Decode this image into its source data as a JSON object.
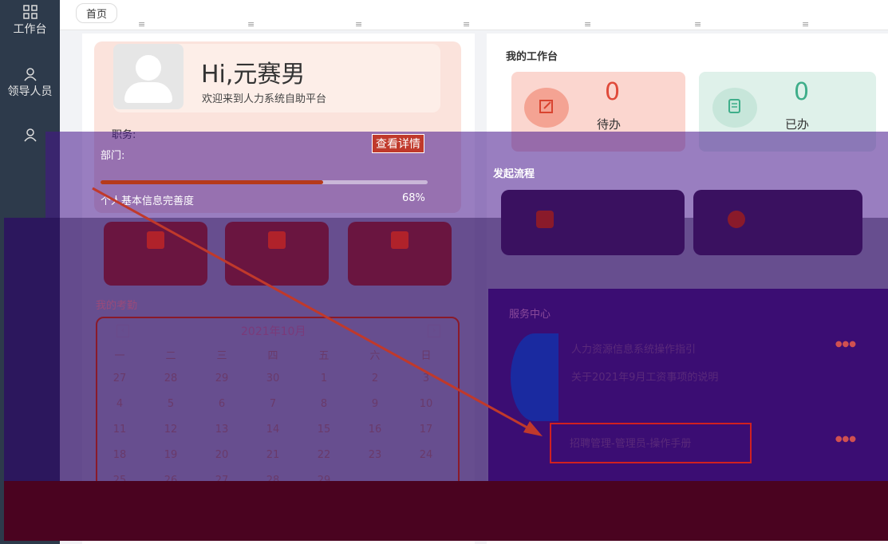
{
  "sidebar": {
    "items": [
      {
        "label": "工作台",
        "icon": "grid-icon"
      },
      {
        "label": "领导人员",
        "icon": "person-icon"
      },
      {
        "label": "",
        "icon": "person-icon"
      }
    ]
  },
  "topbar": {
    "tab": "首页"
  },
  "profile": {
    "greeting": "Hi,元赛男",
    "welcome": "欢迎来到人力系统自助平台",
    "position_label": "职务:",
    "department_label": "部门:",
    "detail_button": "查看详情",
    "completeness_label": "个人基本信息完善度",
    "completeness_pct": "68%",
    "completeness_value": 0.68
  },
  "calendar": {
    "title": "我的考勤",
    "month": "2021年10月",
    "weekdays": [
      "一",
      "二",
      "三",
      "四",
      "五",
      "六",
      "日"
    ],
    "rows": [
      [
        "27",
        "28",
        "29",
        "30",
        "1",
        "2",
        "3"
      ],
      [
        "4",
        "5",
        "6",
        "7",
        "8",
        "9",
        "10"
      ],
      [
        "11",
        "12",
        "13",
        "14",
        "15",
        "16",
        "17"
      ],
      [
        "18",
        "19",
        "20",
        "21",
        "22",
        "23",
        "24"
      ],
      [
        "25",
        "26",
        "27",
        "28",
        "29",
        "",
        ""
      ]
    ]
  },
  "workbench": {
    "title": "我的工作台",
    "todo_count": "0",
    "todo_label": "待办",
    "done_count": "0",
    "done_label": "已办"
  },
  "flow": {
    "title": "发起流程"
  },
  "service": {
    "items": [
      "人力资源信息系统操作指引",
      "关于2021年9月工资事项的说明",
      "招聘管理-管理员-操作手册"
    ]
  },
  "colors": {
    "sidebar_bg": "#2d3a4b",
    "accent_red": "#e04a3a",
    "accent_green": "#3fae8a",
    "overlay_purple": "#46148c"
  }
}
